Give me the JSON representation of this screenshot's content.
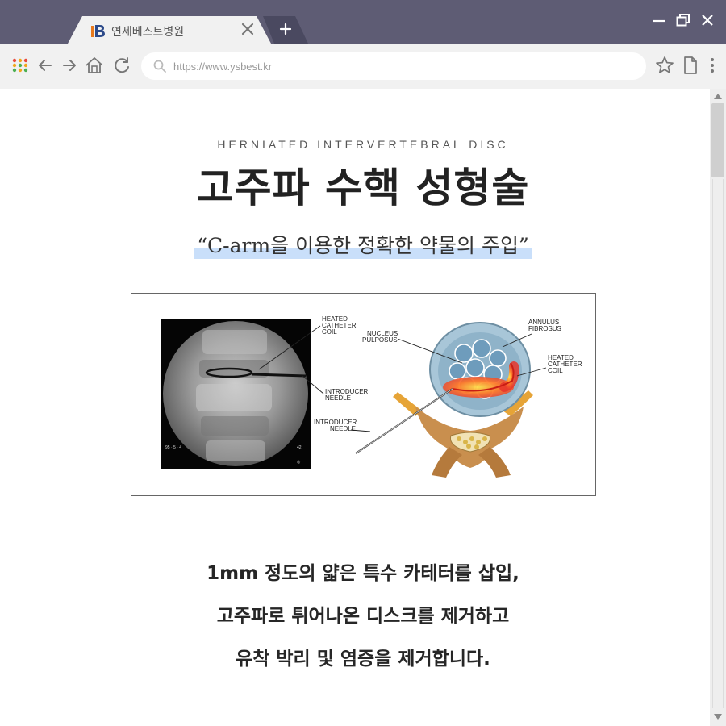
{
  "browser": {
    "tab_title": "연세베스트병원",
    "address_url": "https://www.ysbest.kr"
  },
  "page": {
    "subtitle": "HERNIATED INTERVERTEBRAL DISC",
    "title": "고주파 수핵 성형술",
    "quote": "“C-arm을 이용한 정확한 약물의 주입”",
    "figure": {
      "label_heated_catheter_coil_left": [
        "HEATED",
        "CATHETER",
        "COIL"
      ],
      "label_introducer_needle_left": [
        "INTRODUCER",
        "NEEDLE"
      ],
      "label_nucleus_pulposus": [
        "NUCLEUS",
        "PULPOSUS"
      ],
      "label_annulus_fibrosus": [
        "ANNULUS",
        "FIBROSUS"
      ],
      "label_heated_catheter_coil_right": [
        "HEATED",
        "CATHETER",
        "COIL"
      ],
      "label_introducer_needle_bottom": [
        "INTRODUCER",
        "NEEDLE"
      ]
    },
    "body_lines": [
      "1mm 정도의 얇은 특수 카테터를 삽입,",
      "고주파로 튀어나온 디스크를 제거하고",
      "유착 박리 및 염증을 제거합니다."
    ]
  },
  "colors": {
    "titlebar": "#5e5c74",
    "toolbar": "#f1f1f1",
    "highlight": "#c9dffa",
    "heat": "#e8342a"
  },
  "icons": [
    "logo-icon",
    "close-icon",
    "plus-icon",
    "minimize-icon",
    "restore-icon",
    "apps-icon",
    "back-icon",
    "forward-icon",
    "home-icon",
    "reload-icon",
    "search-icon",
    "star-icon",
    "page-icon",
    "more-icon"
  ]
}
